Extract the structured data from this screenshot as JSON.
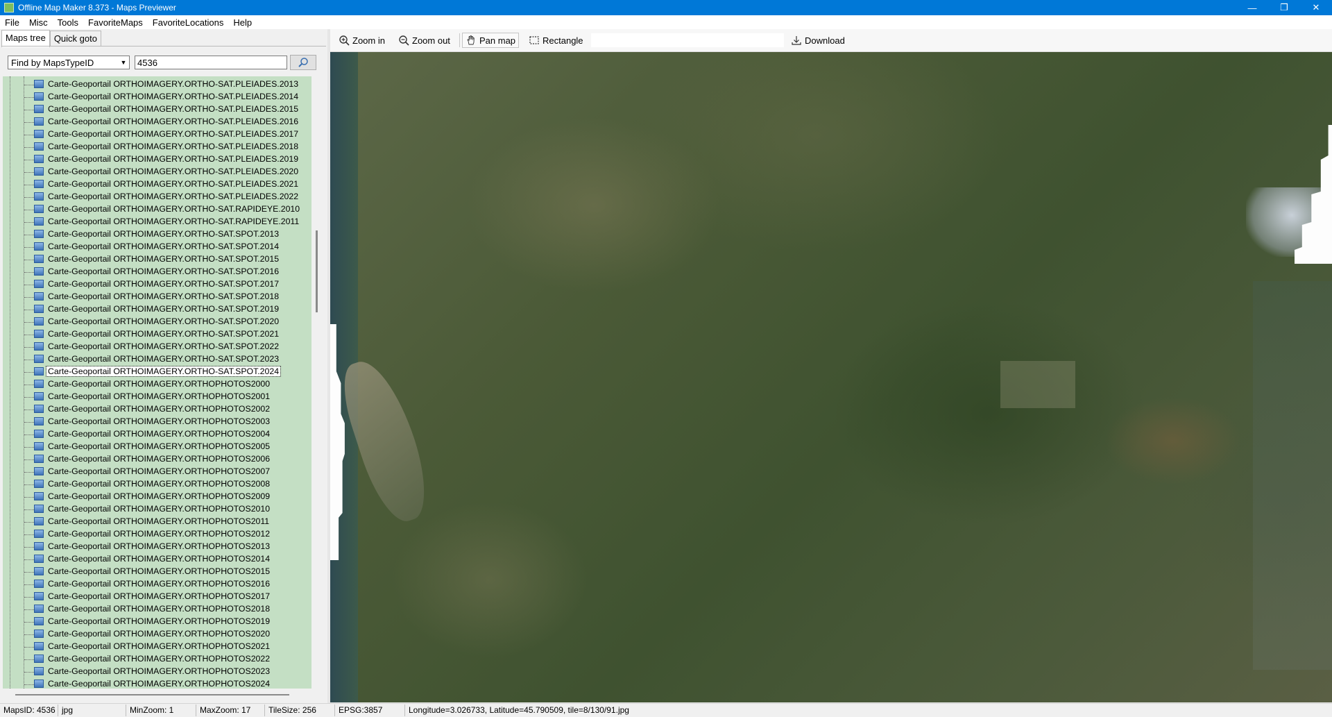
{
  "window": {
    "title": "Offline Map Maker 8.373 - Maps Previewer",
    "minimize_glyph": "—",
    "restore_glyph": "❐",
    "close_glyph": "✕"
  },
  "menu": [
    "File",
    "Misc",
    "Tools",
    "FavoriteMaps",
    "FavoriteLocations",
    "Help"
  ],
  "left_panel": {
    "tabs": [
      "Maps tree",
      "Quick goto"
    ],
    "active_tab": "Maps tree",
    "find_mode": "Find by MapsTypeID",
    "find_value": "4536",
    "tree_items": [
      "Carte-Geoportail ORTHOIMAGERY.ORTHO-SAT.PLEIADES.2013",
      "Carte-Geoportail ORTHOIMAGERY.ORTHO-SAT.PLEIADES.2014",
      "Carte-Geoportail ORTHOIMAGERY.ORTHO-SAT.PLEIADES.2015",
      "Carte-Geoportail ORTHOIMAGERY.ORTHO-SAT.PLEIADES.2016",
      "Carte-Geoportail ORTHOIMAGERY.ORTHO-SAT.PLEIADES.2017",
      "Carte-Geoportail ORTHOIMAGERY.ORTHO-SAT.PLEIADES.2018",
      "Carte-Geoportail ORTHOIMAGERY.ORTHO-SAT.PLEIADES.2019",
      "Carte-Geoportail ORTHOIMAGERY.ORTHO-SAT.PLEIADES.2020",
      "Carte-Geoportail ORTHOIMAGERY.ORTHO-SAT.PLEIADES.2021",
      "Carte-Geoportail ORTHOIMAGERY.ORTHO-SAT.PLEIADES.2022",
      "Carte-Geoportail ORTHOIMAGERY.ORTHO-SAT.RAPIDEYE.2010",
      "Carte-Geoportail ORTHOIMAGERY.ORTHO-SAT.RAPIDEYE.2011",
      "Carte-Geoportail ORTHOIMAGERY.ORTHO-SAT.SPOT.2013",
      "Carte-Geoportail ORTHOIMAGERY.ORTHO-SAT.SPOT.2014",
      "Carte-Geoportail ORTHOIMAGERY.ORTHO-SAT.SPOT.2015",
      "Carte-Geoportail ORTHOIMAGERY.ORTHO-SAT.SPOT.2016",
      "Carte-Geoportail ORTHOIMAGERY.ORTHO-SAT.SPOT.2017",
      "Carte-Geoportail ORTHOIMAGERY.ORTHO-SAT.SPOT.2018",
      "Carte-Geoportail ORTHOIMAGERY.ORTHO-SAT.SPOT.2019",
      "Carte-Geoportail ORTHOIMAGERY.ORTHO-SAT.SPOT.2020",
      "Carte-Geoportail ORTHOIMAGERY.ORTHO-SAT.SPOT.2021",
      "Carte-Geoportail ORTHOIMAGERY.ORTHO-SAT.SPOT.2022",
      "Carte-Geoportail ORTHOIMAGERY.ORTHO-SAT.SPOT.2023",
      "Carte-Geoportail ORTHOIMAGERY.ORTHO-SAT.SPOT.2024",
      "Carte-Geoportail ORTHOIMAGERY.ORTHOPHOTOS2000",
      "Carte-Geoportail ORTHOIMAGERY.ORTHOPHOTOS2001",
      "Carte-Geoportail ORTHOIMAGERY.ORTHOPHOTOS2002",
      "Carte-Geoportail ORTHOIMAGERY.ORTHOPHOTOS2003",
      "Carte-Geoportail ORTHOIMAGERY.ORTHOPHOTOS2004",
      "Carte-Geoportail ORTHOIMAGERY.ORTHOPHOTOS2005",
      "Carte-Geoportail ORTHOIMAGERY.ORTHOPHOTOS2006",
      "Carte-Geoportail ORTHOIMAGERY.ORTHOPHOTOS2007",
      "Carte-Geoportail ORTHOIMAGERY.ORTHOPHOTOS2008",
      "Carte-Geoportail ORTHOIMAGERY.ORTHOPHOTOS2009",
      "Carte-Geoportail ORTHOIMAGERY.ORTHOPHOTOS2010",
      "Carte-Geoportail ORTHOIMAGERY.ORTHOPHOTOS2011",
      "Carte-Geoportail ORTHOIMAGERY.ORTHOPHOTOS2012",
      "Carte-Geoportail ORTHOIMAGERY.ORTHOPHOTOS2013",
      "Carte-Geoportail ORTHOIMAGERY.ORTHOPHOTOS2014",
      "Carte-Geoportail ORTHOIMAGERY.ORTHOPHOTOS2015",
      "Carte-Geoportail ORTHOIMAGERY.ORTHOPHOTOS2016",
      "Carte-Geoportail ORTHOIMAGERY.ORTHOPHOTOS2017",
      "Carte-Geoportail ORTHOIMAGERY.ORTHOPHOTOS2018",
      "Carte-Geoportail ORTHOIMAGERY.ORTHOPHOTOS2019",
      "Carte-Geoportail ORTHOIMAGERY.ORTHOPHOTOS2020",
      "Carte-Geoportail ORTHOIMAGERY.ORTHOPHOTOS2021",
      "Carte-Geoportail ORTHOIMAGERY.ORTHOPHOTOS2022",
      "Carte-Geoportail ORTHOIMAGERY.ORTHOPHOTOS2023",
      "Carte-Geoportail ORTHOIMAGERY.ORTHOPHOTOS2024"
    ],
    "selected_item": "Carte-Geoportail ORTHOIMAGERY.ORTHO-SAT.SPOT.2024"
  },
  "toolbar": {
    "zoom_in": "Zoom in",
    "zoom_out": "Zoom out",
    "pan_map": "Pan map",
    "rectangle": "Rectangle",
    "download": "Download",
    "active_tool": "Pan map"
  },
  "statusbar": {
    "maps_id": "MapsID: 4536",
    "format": "jpg",
    "min_zoom": "MinZoom: 1",
    "max_zoom": "MaxZoom: 17",
    "tile_size": "TileSize: 256",
    "epsg": "EPSG:3857",
    "position": "Longitude=3.026733, Latitude=45.790509, tile=8/130/91.jpg"
  },
  "colors": {
    "titlebar": "#0078d7",
    "tree_background": "#c4dfc4"
  }
}
